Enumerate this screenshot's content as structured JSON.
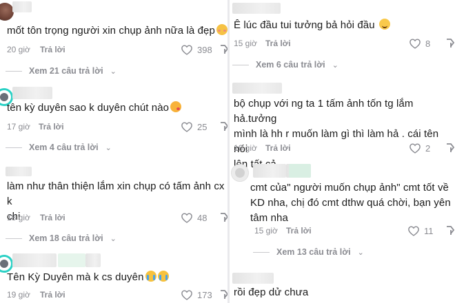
{
  "icons": {
    "like": "heart-outline-icon",
    "share": "share-arrow-icon",
    "expand": "chevron-down-icon"
  },
  "colors": {
    "meta_text": "#8a8b91",
    "body_text": "#1a1a1a",
    "avatar_ring": "#2bd1c5"
  },
  "left_comments": [
    {
      "text": "mốt tôn trọng người xin chụp ảnh nữa là đẹp",
      "time": "20 giờ",
      "reply": "Trả lời",
      "likes": "398",
      "view_replies": "Xem 21 câu trả lời",
      "emoji": "smiling-face-with-hearts"
    },
    {
      "text": "tên kỳ duyên sao k duyên chút nào",
      "time": "17 giờ",
      "reply": "Trả lời",
      "likes": "25",
      "view_replies": "Xem 4 câu trả lời",
      "emoji": "kissing-face"
    },
    {
      "text_lines": [
        "làm như thân thiện lắm xin chụp có tấm ảnh cx k",
        "chi"
      ],
      "time": "18 giờ",
      "reply": "Trả lời",
      "likes": "48",
      "view_replies": "Xem 18 câu trả lời"
    },
    {
      "text": "Tên Kỳ Duyên mà k cs duyên",
      "time": "19 giờ",
      "reply": "Trả lời",
      "likes": "173",
      "emoji": "crying-face"
    }
  ],
  "right_comments": [
    {
      "text": "Ê lúc đầu tui tưởng bả hỏi đầu",
      "time": "15 giờ",
      "reply": "Trả lời",
      "likes": "8",
      "view_replies": "Xem 6 câu trả lời",
      "emoji": "grinning-face"
    },
    {
      "text_lines": [
        "bộ chụp với ng ta 1 tấm ảnh tốn tg lắm hả.tưởng",
        "mình là hh r muốn làm gì thì làm hả . cái tên nói",
        "lên tất cả"
      ],
      "time": "16 giờ",
      "reply": "Trả lời",
      "likes": "2"
    },
    {
      "text_lines": [
        "cmt của\" người muốn chụp ảnh\" cmt tốt về",
        "KD nha, chị đó cmt dthw quá chời, bạn yên",
        "tâm nha"
      ],
      "time": "15 giờ",
      "reply": "Trả lời",
      "likes": "11",
      "view_replies": "Xem 13 câu trả lời"
    },
    {
      "text": "rồi đẹp dử chưa"
    }
  ]
}
